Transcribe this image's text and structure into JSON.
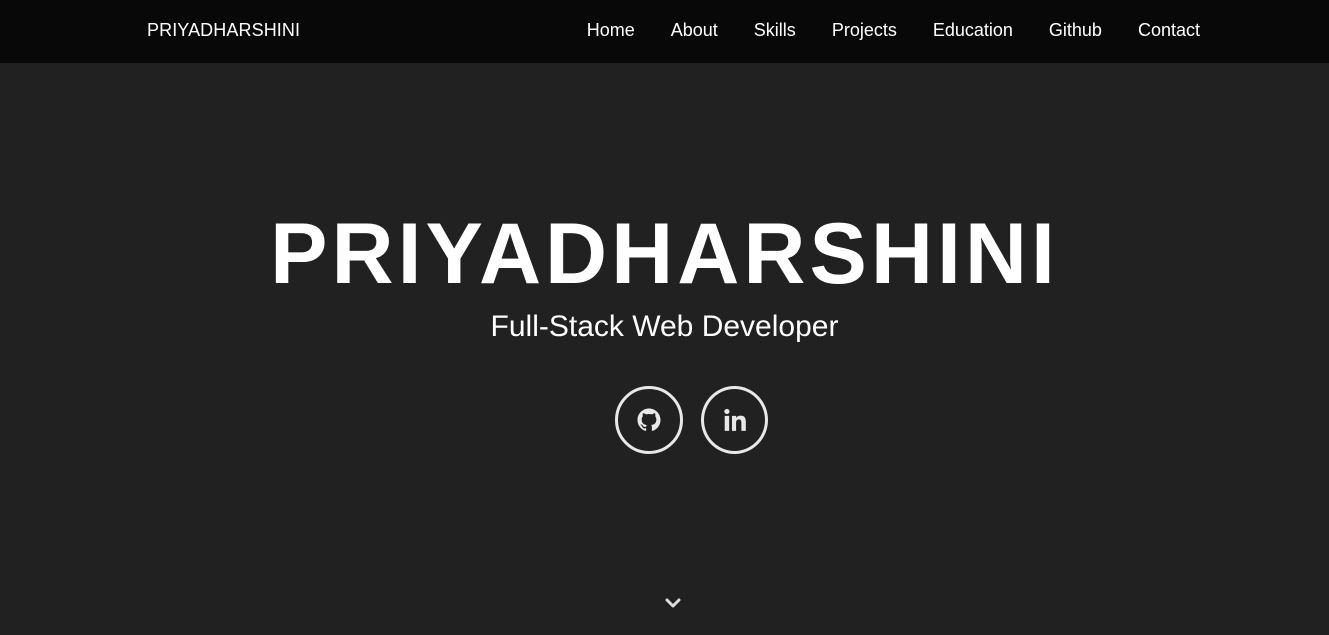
{
  "nav": {
    "brand": "PRIYADHARSHINI",
    "links": [
      {
        "label": "Home"
      },
      {
        "label": "About"
      },
      {
        "label": "Skills"
      },
      {
        "label": "Projects"
      },
      {
        "label": "Education"
      },
      {
        "label": "Github"
      },
      {
        "label": "Contact"
      }
    ]
  },
  "hero": {
    "title": "PRIYADHARSHINI",
    "subtitle": "Full-Stack Web Developer",
    "social": [
      {
        "icon": "github-icon"
      },
      {
        "icon": "linkedin-icon"
      }
    ],
    "scroll_icon": "chevron-down-icon"
  },
  "colors": {
    "navbar_bg": "#080808",
    "page_bg": "#212121",
    "text": "#ffffff",
    "icon": "#e8e8e8"
  }
}
